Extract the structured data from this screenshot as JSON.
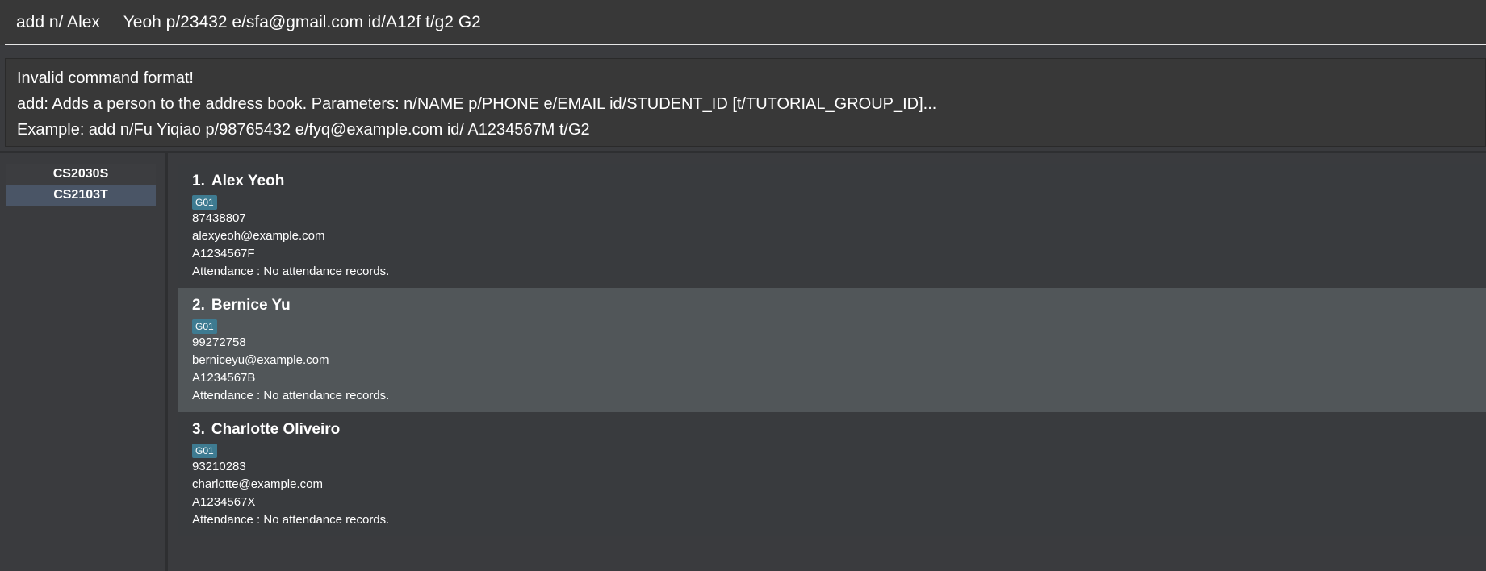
{
  "command": {
    "value": "add n/ Alex     Yeoh p/23432 e/sfa@gmail.com id/A12f t/g2 G2"
  },
  "result": {
    "lines": [
      "Invalid command format!",
      "add: Adds a person to the address book. Parameters: n/NAME p/PHONE e/EMAIL id/STUDENT_ID [t/TUTORIAL_GROUP_ID]...",
      "Example: add n/Fu Yiqiao p/98765432 e/fyq@example.com id/ A1234567M t/G2"
    ]
  },
  "modules": [
    {
      "label": "CS2030S",
      "selected": false
    },
    {
      "label": "CS2103T",
      "selected": true
    }
  ],
  "persons": [
    {
      "index": "1.",
      "name": "Alex Yeoh",
      "tag": "G01",
      "phone": "87438807",
      "email": "alexyeoh@example.com",
      "student_id": "A1234567F",
      "attendance": "Attendance : No attendance records."
    },
    {
      "index": "2.",
      "name": "Bernice Yu",
      "tag": "G01",
      "phone": "99272758",
      "email": "berniceyu@example.com",
      "student_id": "A1234567B",
      "attendance": "Attendance : No attendance records."
    },
    {
      "index": "3.",
      "name": "Charlotte Oliveiro",
      "tag": "G01",
      "phone": "93210283",
      "email": "charlotte@example.com",
      "student_id": "A1234567X",
      "attendance": "Attendance : No attendance records."
    }
  ],
  "colors": {
    "background": "#3a3b3e",
    "selected_module": "#4a5566",
    "tag": "#3e7b91",
    "selected_card": "#515659"
  }
}
